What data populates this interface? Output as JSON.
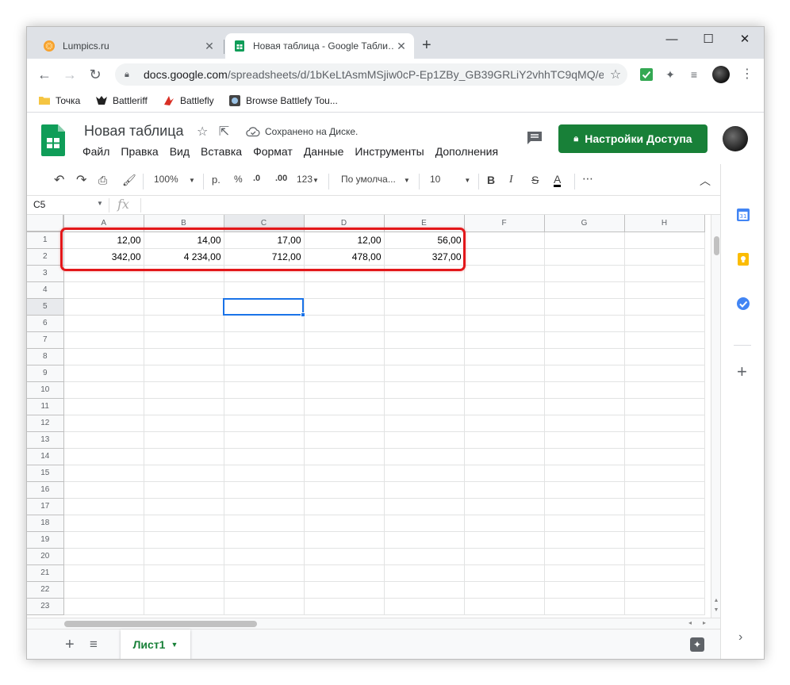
{
  "browser": {
    "tabs": [
      {
        "title": "Lumpics.ru",
        "close": "✕"
      },
      {
        "title": "Новая таблица - Google Табли…",
        "close": "✕"
      }
    ],
    "new_tab": "+",
    "window_controls": {
      "minimize": "—",
      "maximize": "☐",
      "close": "✕"
    },
    "url_host": "docs.google.com",
    "url_path": "/spreadsheets/d/1bKeLtAsmMSjiw0cP-Ep1ZBy_GB39GRLiY2vhhTC9qMQ/e...",
    "bookmarks": [
      {
        "label": "Точка",
        "icon": "folder-icon"
      },
      {
        "label": "Battleriff",
        "icon": "battleriff-icon"
      },
      {
        "label": "Battlefly",
        "icon": "battlefly-icon"
      },
      {
        "label": "Browse Battlefy Tou...",
        "icon": "battlefy-icon"
      }
    ]
  },
  "doc": {
    "title": "Новая таблица",
    "saved_status": "Сохранено на Диске.",
    "menus": [
      "Файл",
      "Правка",
      "Вид",
      "Вставка",
      "Формат",
      "Данные",
      "Инструменты",
      "Дополнения"
    ],
    "share_label": "Настройки Доступа"
  },
  "toolbar": {
    "zoom": "100%",
    "currency": "р.",
    "percent": "%",
    "dec_decrease": ".0",
    "dec_increase": ".00",
    "more_formats": "123",
    "font": "По умолча...",
    "font_size": "10",
    "bold": "B",
    "italic": "I",
    "strike": "S",
    "text_color": "A",
    "more": "⋯"
  },
  "formula_bar": {
    "cell_ref": "C5",
    "fx": "fx",
    "value": ""
  },
  "grid": {
    "columns": [
      "A",
      "B",
      "C",
      "D",
      "E",
      "F",
      "G",
      "H"
    ],
    "selected_column": "C",
    "selected_row": "5",
    "selected_cell": "C5",
    "rows": [
      {
        "n": "1",
        "cells": [
          "12,00",
          "14,00",
          "17,00",
          "12,00",
          "56,00",
          "",
          "",
          ""
        ]
      },
      {
        "n": "2",
        "cells": [
          "342,00",
          "4 234,00",
          "712,00",
          "478,00",
          "327,00",
          "",
          "",
          ""
        ]
      },
      {
        "n": "3",
        "cells": [
          "",
          "",
          "",
          "",
          "",
          "",
          "",
          ""
        ]
      },
      {
        "n": "4",
        "cells": [
          "",
          "",
          "",
          "",
          "",
          "",
          "",
          ""
        ]
      },
      {
        "n": "5",
        "cells": [
          "",
          "",
          "",
          "",
          "",
          "",
          "",
          ""
        ]
      },
      {
        "n": "6",
        "cells": [
          "",
          "",
          "",
          "",
          "",
          "",
          "",
          ""
        ]
      },
      {
        "n": "7",
        "cells": [
          "",
          "",
          "",
          "",
          "",
          "",
          "",
          ""
        ]
      },
      {
        "n": "8",
        "cells": [
          "",
          "",
          "",
          "",
          "",
          "",
          "",
          ""
        ]
      },
      {
        "n": "9",
        "cells": [
          "",
          "",
          "",
          "",
          "",
          "",
          "",
          ""
        ]
      },
      {
        "n": "10",
        "cells": [
          "",
          "",
          "",
          "",
          "",
          "",
          "",
          ""
        ]
      },
      {
        "n": "11",
        "cells": [
          "",
          "",
          "",
          "",
          "",
          "",
          "",
          ""
        ]
      },
      {
        "n": "12",
        "cells": [
          "",
          "",
          "",
          "",
          "",
          "",
          "",
          ""
        ]
      },
      {
        "n": "13",
        "cells": [
          "",
          "",
          "",
          "",
          "",
          "",
          "",
          ""
        ]
      },
      {
        "n": "14",
        "cells": [
          "",
          "",
          "",
          "",
          "",
          "",
          "",
          ""
        ]
      },
      {
        "n": "15",
        "cells": [
          "",
          "",
          "",
          "",
          "",
          "",
          "",
          ""
        ]
      },
      {
        "n": "16",
        "cells": [
          "",
          "",
          "",
          "",
          "",
          "",
          "",
          ""
        ]
      },
      {
        "n": "17",
        "cells": [
          "",
          "",
          "",
          "",
          "",
          "",
          "",
          ""
        ]
      },
      {
        "n": "18",
        "cells": [
          "",
          "",
          "",
          "",
          "",
          "",
          "",
          ""
        ]
      },
      {
        "n": "19",
        "cells": [
          "",
          "",
          "",
          "",
          "",
          "",
          "",
          ""
        ]
      },
      {
        "n": "20",
        "cells": [
          "",
          "",
          "",
          "",
          "",
          "",
          "",
          ""
        ]
      },
      {
        "n": "21",
        "cells": [
          "",
          "",
          "",
          "",
          "",
          "",
          "",
          ""
        ]
      },
      {
        "n": "22",
        "cells": [
          "",
          "",
          "",
          "",
          "",
          "",
          "",
          ""
        ]
      },
      {
        "n": "23",
        "cells": [
          "",
          "",
          "",
          "",
          "",
          "",
          "",
          ""
        ]
      }
    ]
  },
  "sheet_tabs": [
    {
      "label": "Лист1"
    }
  ],
  "colors": {
    "share_green": "#188038",
    "highlight_red": "#e3171a",
    "selection_blue": "#1a73e8"
  }
}
